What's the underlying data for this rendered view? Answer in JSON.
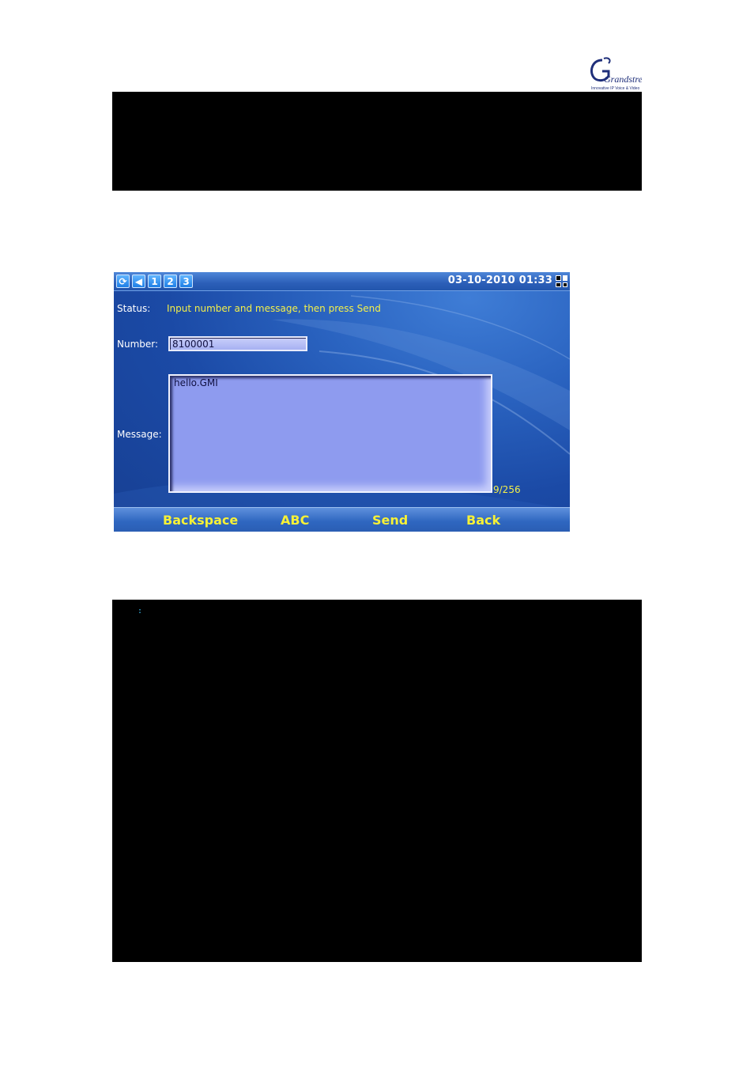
{
  "logo": {
    "name": "Grandstream",
    "tagline": "Innovative IP Voice & Video"
  },
  "device": {
    "status_icons": [
      {
        "icon": "sync-icon",
        "glyph": "⟳"
      },
      {
        "icon": "speaker-icon",
        "glyph": "◀"
      },
      {
        "icon": "line-1-icon",
        "glyph": "1"
      },
      {
        "icon": "line-2-icon",
        "glyph": "2"
      },
      {
        "icon": "line-3-icon",
        "glyph": "3"
      }
    ],
    "datetime": "03-10-2010 01:33",
    "status_label": "Status:",
    "status_text": "Input number and message, then press Send",
    "number_label": "Number:",
    "number_value": "8100001",
    "message_label": "Message:",
    "message_value": "hello.GMI",
    "char_counter": "9/256",
    "softkeys": [
      "Backspace",
      "ABC",
      "Send",
      "Back"
    ]
  },
  "colors": {
    "status_yellow": "#f4f04a",
    "softkey_yellow": "#f7f136",
    "screen_blue": "#1b4aa6",
    "message_fill": "#8e9bef"
  }
}
